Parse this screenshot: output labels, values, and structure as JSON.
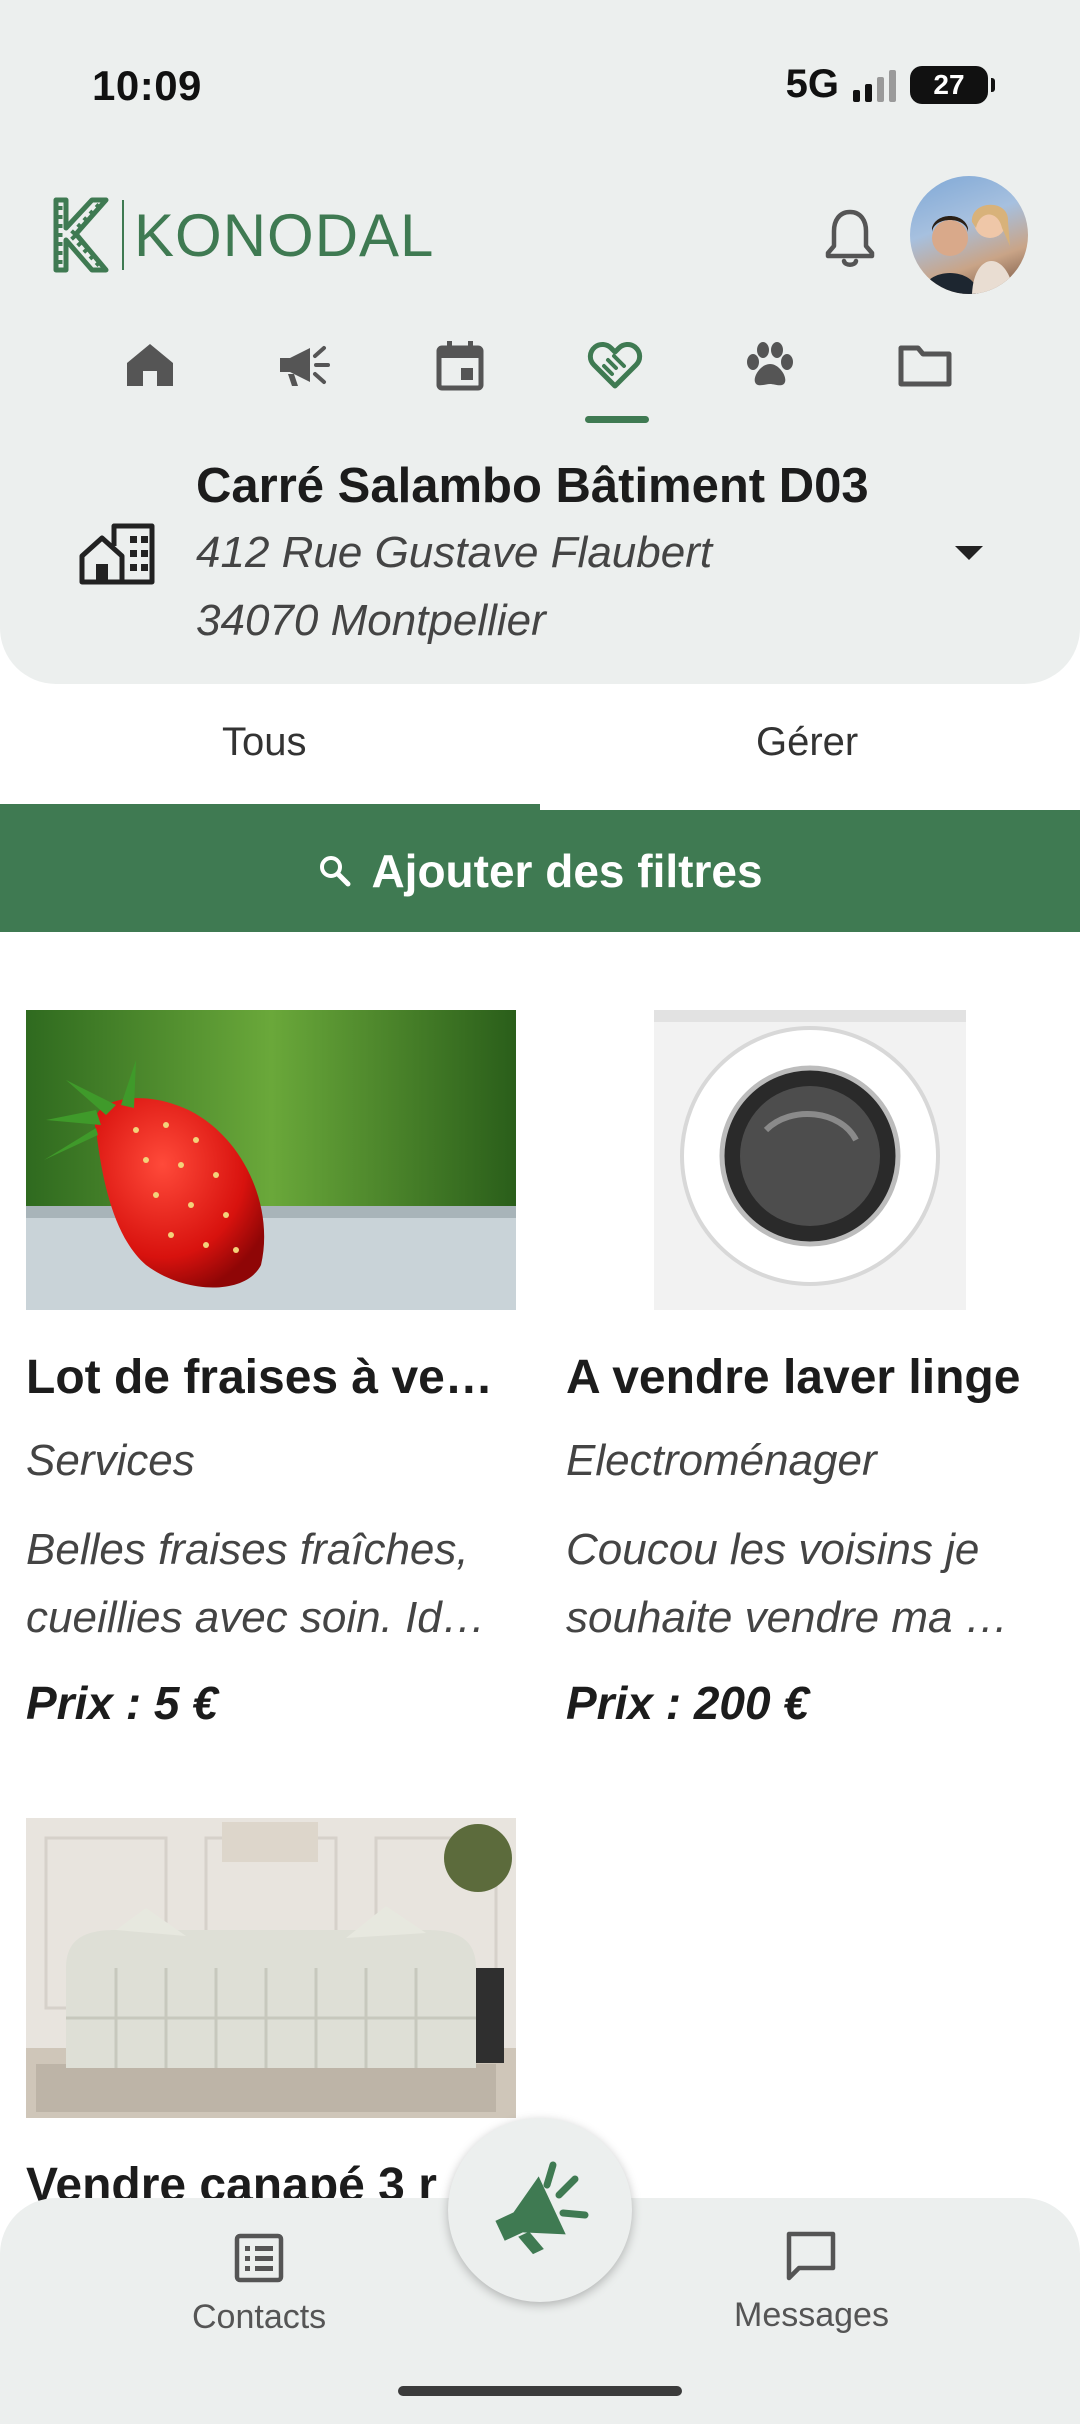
{
  "status_bar": {
    "time": "10:09",
    "network": "5G",
    "battery": "27"
  },
  "app": {
    "name": "KONODAL"
  },
  "nav_icons": [
    "home-icon",
    "megaphone-icon",
    "calendar-icon",
    "handshake-icon",
    "paw-icon",
    "folder-icon"
  ],
  "residence": {
    "name": "Carré Salambo Bâtiment D03",
    "address_line1": "412 Rue Gustave Flaubert",
    "address_line2": "34070 Montpellier"
  },
  "tabs": {
    "all": "Tous",
    "manage": "Gérer"
  },
  "filter": {
    "label": "Ajouter des filtres"
  },
  "listings": [
    {
      "title": "Lot de fraises à ve…",
      "category": "Services",
      "desc_line1": "Belles fraises fraîches,",
      "desc_line2": "cueillies avec soin. Id…",
      "price": "Prix : 5 €",
      "image": "strawberry"
    },
    {
      "title": "A vendre laver linge",
      "category": "Electroménager",
      "desc_line1": "Coucou les voisins je",
      "desc_line2": "souhaite vendre ma …",
      "price": "Prix : 200 €",
      "image": "washing-machine"
    },
    {
      "title": "Vendre canapé 3 r",
      "image": "sofa"
    }
  ],
  "bottom_nav": {
    "contacts": "Contacts",
    "messages": "Messages"
  },
  "colors": {
    "brand_green": "#3f7a52",
    "panel_bg": "#ecefee"
  }
}
